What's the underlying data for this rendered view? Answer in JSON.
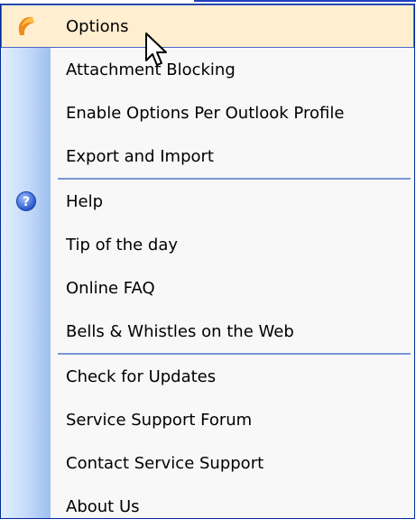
{
  "menu": {
    "items": [
      {
        "label": "Options",
        "icon": "app-flame-icon",
        "selected": true
      },
      {
        "label": "Attachment Blocking"
      },
      {
        "label": "Enable Options Per Outlook Profile"
      },
      {
        "label": "Export and Import"
      },
      {
        "label": "Help",
        "icon": "help-icon"
      },
      {
        "label": "Tip of the day"
      },
      {
        "label": "Online FAQ"
      },
      {
        "label": "Bells & Whistles on the Web"
      },
      {
        "label": "Check for Updates"
      },
      {
        "label": "Service Support Forum"
      },
      {
        "label": "Contact Service Support"
      },
      {
        "label": "About Us"
      }
    ]
  },
  "colors": {
    "border": "#002d96",
    "selected_bg": "#ffeed0",
    "separator": "#7b96d6",
    "gutter": "#c4dafb"
  }
}
